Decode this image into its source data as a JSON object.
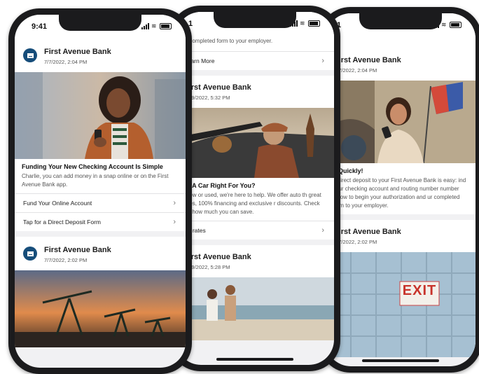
{
  "status": {
    "time": "9:41",
    "time_partial_middle": "1",
    "time_partial_right": "1"
  },
  "bank_name": "First Avenue Bank",
  "phone_left": {
    "card1": {
      "bank": "First Avenue Bank",
      "date": "7/7/2022, 2:04 PM",
      "headline": "Funding Your New Checking Account Is Simple",
      "body": "Charlie, you can add money in a snap online or on the First Avenue Bank app.",
      "link1": "Fund Your Online Account",
      "link2": "Tap for a Direct Deposit Form"
    },
    "card2": {
      "bank": "First Avenue Bank",
      "date": "7/7/2022, 2:02 PM"
    }
  },
  "phone_middle": {
    "top_text": "ur completed form to your employer.",
    "learn_more": "Learn More",
    "card1": {
      "bank": "First Avenue Bank",
      "date": "7/19/2022, 5:32 PM",
      "headline": "ng A Car Right For You?",
      "body": "r new or used, we're here to help. We offer auto th great rates, 100% financing and exclusive r discounts. Check out how much you can save.",
      "link": "an rates"
    },
    "card2": {
      "bank": "First Avenue Bank",
      "date": "7/19/2022, 5:28 PM"
    }
  },
  "phone_right": {
    "card1": {
      "bank": "First Avenue Bank",
      "date": "7/7/2022, 2:04 PM",
      "headline": "d Quickly!",
      "body": "p direct deposit to your First Avenue Bank is easy: ind your checking account and routing number number below to begin your authorization and ur completed form to your employer."
    },
    "card2": {
      "bank": "First Avenue Bank",
      "date": "7/7/2022, 2:02 PM"
    },
    "exit_sign": "EXIT"
  },
  "chevron": "›"
}
